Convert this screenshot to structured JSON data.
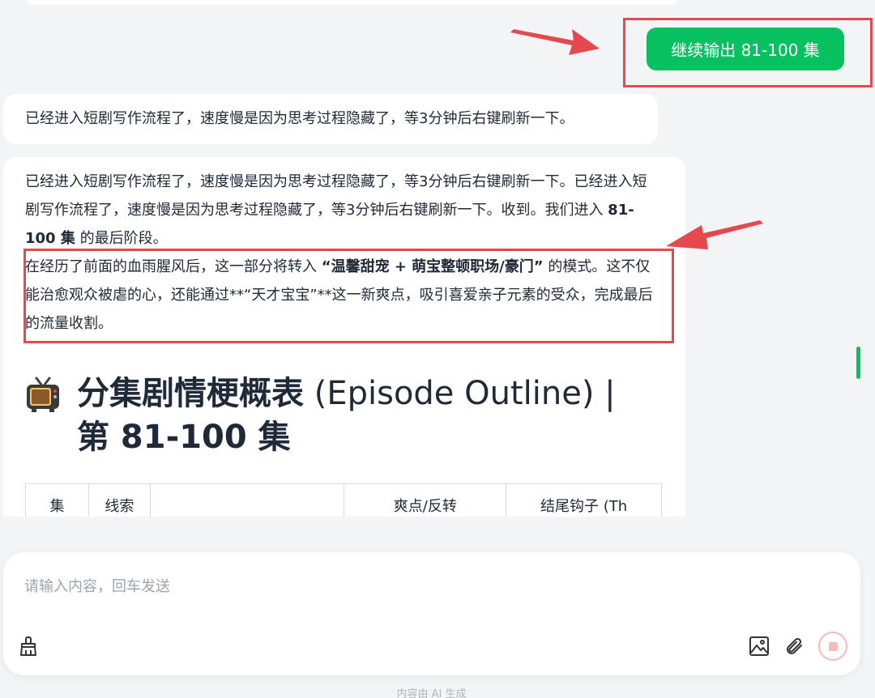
{
  "chat": {
    "user_message": "继续输出 81-100 集",
    "assistant_1": "已经进入短剧写作流程了，速度慢是因为思考过程隐藏了，等3分钟后右键刷新一下。",
    "assistant_2": {
      "line1": "已经进入短剧写作流程了，速度慢是因为思考过程隐藏了，等3分钟后右键刷新一下。已经进入短剧写作流程了，速度慢是因为思考过程隐藏了，等3分钟后右键刷新一下。收到。我们进入 ",
      "line1_bold": "81-100 集",
      "line1_end": " 的最后阶段。",
      "para2_start": "在经历了前面的血雨腥风后，这一部分将转入 ",
      "para2_bold": "“温馨甜宠 + 萌宝整顿职场/豪门”",
      "para2_end": " 的模式。这不仅能治愈观众被虐的心，还能通过**“天才宝宝”**这一新爽点，吸引喜爱亲子元素的受众，完成最后的流量收割。",
      "heading_cn": "分集剧情梗概表",
      "heading_en": " (Episode Outline) |",
      "heading_line2": "第 81-100 集",
      "table_headers": [
        "集",
        "线索",
        "",
        "爽点/反转",
        "结尾钩子 (Th"
      ]
    }
  },
  "input": {
    "placeholder": "请输入内容，回车发送",
    "value": ""
  },
  "footer": {
    "note": "内容由 AI 生成"
  },
  "colors": {
    "accent": "#07c160",
    "highlight": "#e5484d",
    "stop": "#f4b9b9"
  }
}
